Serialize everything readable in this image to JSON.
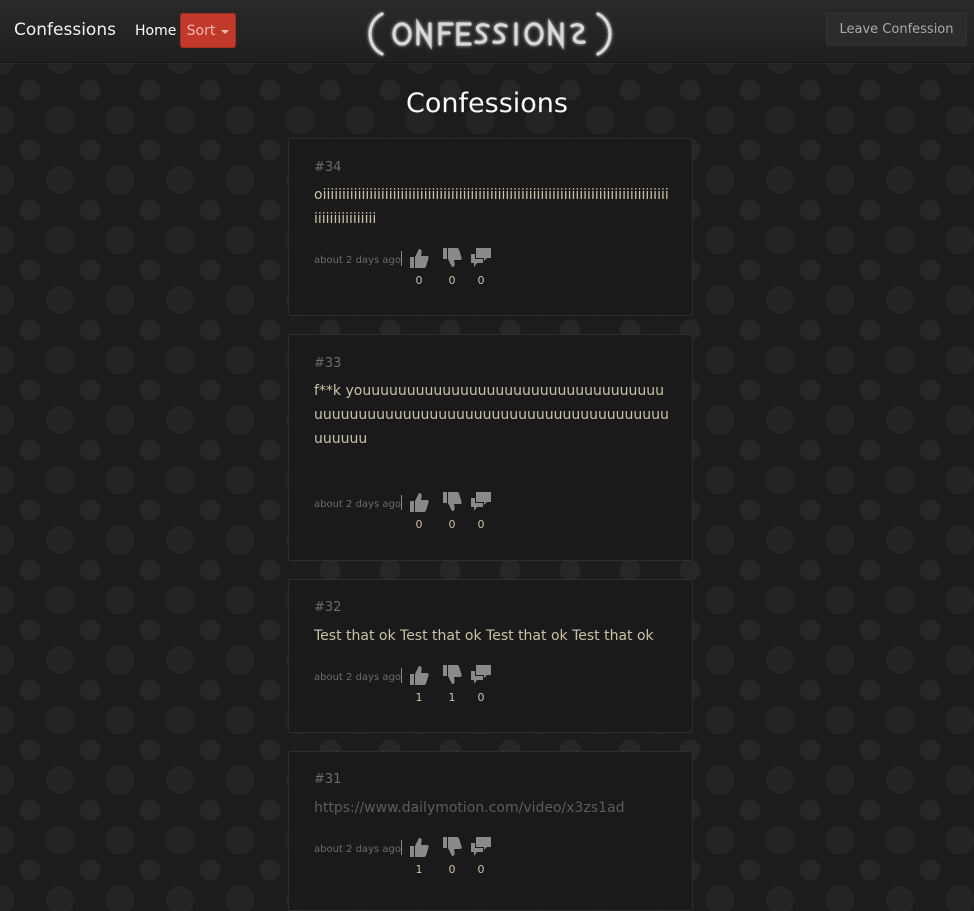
{
  "navbar": {
    "brand": "Confessions",
    "home_label": "Home",
    "sort_label": "Sort",
    "leave_label": "Leave Confession"
  },
  "logo": {
    "text": "(ONFESSIONS)"
  },
  "page": {
    "title": "Confessions"
  },
  "confessions": [
    {
      "number": "#34",
      "text": "oiiiiiiiiiiiiiiiiiiiiiiiiiiiiiiiiiiiiiiiiiiiiiiiiiiiiiiiiiiiiiiiiiiiiiiiiiiiiiiiiiiiiiiiiiiiiiiiiiiiiiiiii",
      "time": "about 2 days ago",
      "likes": "0",
      "dislikes": "0",
      "comments": "0"
    },
    {
      "number": "#33",
      "text": "f**k youuuuuuuuuuuuuuuuuuuuuuuuuuuuuuuuuuuuuuuuuuuuuuuuuuuuuuuuuuuuuuuuuuuuuuuuuuuuuuuu",
      "time": "about 2 days ago",
      "likes": "0",
      "dislikes": "0",
      "comments": "0"
    },
    {
      "number": "#32",
      "text": "Test that ok Test that ok Test that ok Test that ok",
      "time": "about 2 days ago",
      "likes": "1",
      "dislikes": "1",
      "comments": "0"
    },
    {
      "number": "#31",
      "text": "https://www.dailymotion.com/video/x3zs1ad",
      "time": "about 2 days ago",
      "likes": "1",
      "dislikes": "0",
      "comments": "0"
    }
  ],
  "icons": {
    "like": "thumbs-up-icon",
    "dislike": "thumbs-down-icon",
    "comment": "comments-icon"
  },
  "colors": {
    "sort_button": "#c0392b",
    "confession_text": "#c8c2a8",
    "link_text": "#5c5c5c"
  }
}
